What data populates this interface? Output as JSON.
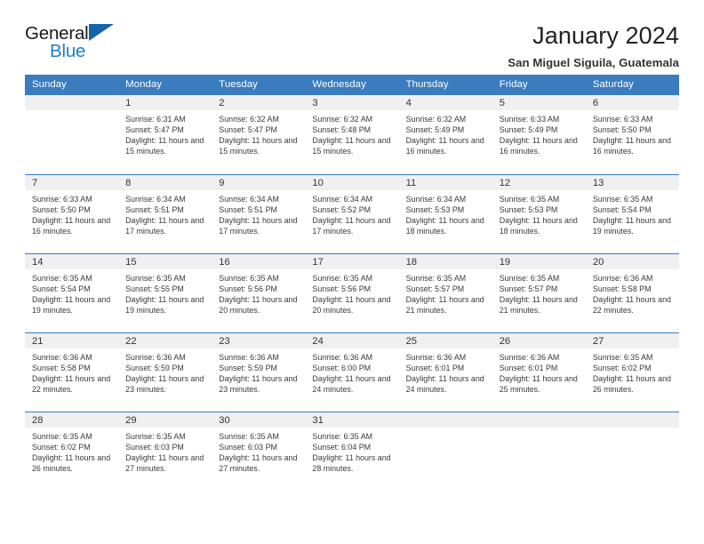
{
  "brand": {
    "name_part1": "General",
    "name_part2": "Blue",
    "flag_icon": "triangle-flag-icon",
    "accent_color": "#1f7fc4",
    "header_color": "#3a7cbe"
  },
  "header": {
    "title": "January 2024",
    "subtitle": "San Miguel Siguila, Guatemala"
  },
  "weekday_headers": [
    "Sunday",
    "Monday",
    "Tuesday",
    "Wednesday",
    "Thursday",
    "Friday",
    "Saturday"
  ],
  "labels": {
    "sunrise_prefix": "Sunrise:",
    "sunset_prefix": "Sunset:",
    "daylight_prefix": "Daylight:"
  },
  "weeks": [
    [
      {
        "day": "",
        "empty": true
      },
      {
        "day": "1",
        "sunrise": "Sunrise: 6:31 AM",
        "sunset": "Sunset: 5:47 PM",
        "daylight": "Daylight: 11 hours and 15 minutes."
      },
      {
        "day": "2",
        "sunrise": "Sunrise: 6:32 AM",
        "sunset": "Sunset: 5:47 PM",
        "daylight": "Daylight: 11 hours and 15 minutes."
      },
      {
        "day": "3",
        "sunrise": "Sunrise: 6:32 AM",
        "sunset": "Sunset: 5:48 PM",
        "daylight": "Daylight: 11 hours and 15 minutes."
      },
      {
        "day": "4",
        "sunrise": "Sunrise: 6:32 AM",
        "sunset": "Sunset: 5:49 PM",
        "daylight": "Daylight: 11 hours and 16 minutes."
      },
      {
        "day": "5",
        "sunrise": "Sunrise: 6:33 AM",
        "sunset": "Sunset: 5:49 PM",
        "daylight": "Daylight: 11 hours and 16 minutes."
      },
      {
        "day": "6",
        "sunrise": "Sunrise: 6:33 AM",
        "sunset": "Sunset: 5:50 PM",
        "daylight": "Daylight: 11 hours and 16 minutes."
      }
    ],
    [
      {
        "day": "7",
        "sunrise": "Sunrise: 6:33 AM",
        "sunset": "Sunset: 5:50 PM",
        "daylight": "Daylight: 11 hours and 16 minutes."
      },
      {
        "day": "8",
        "sunrise": "Sunrise: 6:34 AM",
        "sunset": "Sunset: 5:51 PM",
        "daylight": "Daylight: 11 hours and 17 minutes."
      },
      {
        "day": "9",
        "sunrise": "Sunrise: 6:34 AM",
        "sunset": "Sunset: 5:51 PM",
        "daylight": "Daylight: 11 hours and 17 minutes."
      },
      {
        "day": "10",
        "sunrise": "Sunrise: 6:34 AM",
        "sunset": "Sunset: 5:52 PM",
        "daylight": "Daylight: 11 hours and 17 minutes."
      },
      {
        "day": "11",
        "sunrise": "Sunrise: 6:34 AM",
        "sunset": "Sunset: 5:53 PM",
        "daylight": "Daylight: 11 hours and 18 minutes."
      },
      {
        "day": "12",
        "sunrise": "Sunrise: 6:35 AM",
        "sunset": "Sunset: 5:53 PM",
        "daylight": "Daylight: 11 hours and 18 minutes."
      },
      {
        "day": "13",
        "sunrise": "Sunrise: 6:35 AM",
        "sunset": "Sunset: 5:54 PM",
        "daylight": "Daylight: 11 hours and 19 minutes."
      }
    ],
    [
      {
        "day": "14",
        "sunrise": "Sunrise: 6:35 AM",
        "sunset": "Sunset: 5:54 PM",
        "daylight": "Daylight: 11 hours and 19 minutes."
      },
      {
        "day": "15",
        "sunrise": "Sunrise: 6:35 AM",
        "sunset": "Sunset: 5:55 PM",
        "daylight": "Daylight: 11 hours and 19 minutes."
      },
      {
        "day": "16",
        "sunrise": "Sunrise: 6:35 AM",
        "sunset": "Sunset: 5:56 PM",
        "daylight": "Daylight: 11 hours and 20 minutes."
      },
      {
        "day": "17",
        "sunrise": "Sunrise: 6:35 AM",
        "sunset": "Sunset: 5:56 PM",
        "daylight": "Daylight: 11 hours and 20 minutes."
      },
      {
        "day": "18",
        "sunrise": "Sunrise: 6:35 AM",
        "sunset": "Sunset: 5:57 PM",
        "daylight": "Daylight: 11 hours and 21 minutes."
      },
      {
        "day": "19",
        "sunrise": "Sunrise: 6:35 AM",
        "sunset": "Sunset: 5:57 PM",
        "daylight": "Daylight: 11 hours and 21 minutes."
      },
      {
        "day": "20",
        "sunrise": "Sunrise: 6:36 AM",
        "sunset": "Sunset: 5:58 PM",
        "daylight": "Daylight: 11 hours and 22 minutes."
      }
    ],
    [
      {
        "day": "21",
        "sunrise": "Sunrise: 6:36 AM",
        "sunset": "Sunset: 5:58 PM",
        "daylight": "Daylight: 11 hours and 22 minutes."
      },
      {
        "day": "22",
        "sunrise": "Sunrise: 6:36 AM",
        "sunset": "Sunset: 5:59 PM",
        "daylight": "Daylight: 11 hours and 23 minutes."
      },
      {
        "day": "23",
        "sunrise": "Sunrise: 6:36 AM",
        "sunset": "Sunset: 5:59 PM",
        "daylight": "Daylight: 11 hours and 23 minutes."
      },
      {
        "day": "24",
        "sunrise": "Sunrise: 6:36 AM",
        "sunset": "Sunset: 6:00 PM",
        "daylight": "Daylight: 11 hours and 24 minutes."
      },
      {
        "day": "25",
        "sunrise": "Sunrise: 6:36 AM",
        "sunset": "Sunset: 6:01 PM",
        "daylight": "Daylight: 11 hours and 24 minutes."
      },
      {
        "day": "26",
        "sunrise": "Sunrise: 6:36 AM",
        "sunset": "Sunset: 6:01 PM",
        "daylight": "Daylight: 11 hours and 25 minutes."
      },
      {
        "day": "27",
        "sunrise": "Sunrise: 6:35 AM",
        "sunset": "Sunset: 6:02 PM",
        "daylight": "Daylight: 11 hours and 26 minutes."
      }
    ],
    [
      {
        "day": "28",
        "sunrise": "Sunrise: 6:35 AM",
        "sunset": "Sunset: 6:02 PM",
        "daylight": "Daylight: 11 hours and 26 minutes."
      },
      {
        "day": "29",
        "sunrise": "Sunrise: 6:35 AM",
        "sunset": "Sunset: 6:03 PM",
        "daylight": "Daylight: 11 hours and 27 minutes."
      },
      {
        "day": "30",
        "sunrise": "Sunrise: 6:35 AM",
        "sunset": "Sunset: 6:03 PM",
        "daylight": "Daylight: 11 hours and 27 minutes."
      },
      {
        "day": "31",
        "sunrise": "Sunrise: 6:35 AM",
        "sunset": "Sunset: 6:04 PM",
        "daylight": "Daylight: 11 hours and 28 minutes."
      },
      {
        "day": "",
        "empty": true
      },
      {
        "day": "",
        "empty": true
      },
      {
        "day": "",
        "empty": true
      }
    ]
  ]
}
